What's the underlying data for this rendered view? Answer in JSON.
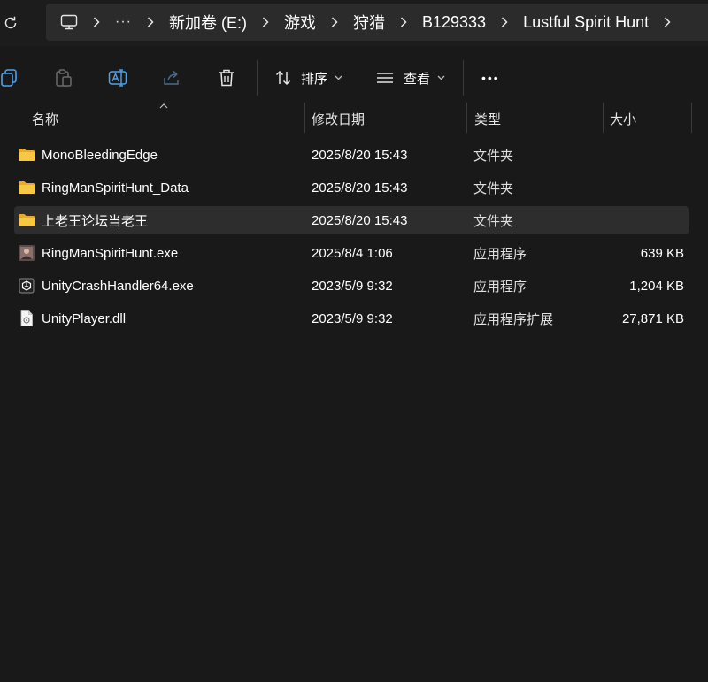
{
  "breadcrumb": {
    "overflow": "···",
    "segments": [
      "新加卷 (E:)",
      "游戏",
      "狩猎",
      "B129333",
      "Lustful Spirit Hunt"
    ]
  },
  "toolbar": {
    "sort_label": "排序",
    "view_label": "查看",
    "more_label": "•••"
  },
  "columns": {
    "name": "名称",
    "modified": "修改日期",
    "type": "类型",
    "size": "大小"
  },
  "files": [
    {
      "name": "MonoBleedingEdge",
      "modified": "2025/8/20 15:43",
      "type": "文件夹",
      "size": "",
      "icon": "folder-icon"
    },
    {
      "name": "RingManSpiritHunt_Data",
      "modified": "2025/8/20 15:43",
      "type": "文件夹",
      "size": "",
      "icon": "folder-icon"
    },
    {
      "name": "上老王论坛当老王",
      "modified": "2025/8/20 15:43",
      "type": "文件夹",
      "size": "",
      "icon": "folder-icon"
    },
    {
      "name": "RingManSpiritHunt.exe",
      "modified": "2025/8/4 1:06",
      "type": "应用程序",
      "size": "639 KB",
      "icon": "app-exe-icon"
    },
    {
      "name": "UnityCrashHandler64.exe",
      "modified": "2023/5/9 9:32",
      "type": "应用程序",
      "size": "1,204 KB",
      "icon": "unity-exe-icon"
    },
    {
      "name": "UnityPlayer.dll",
      "modified": "2023/5/9 9:32",
      "type": "应用程序扩展",
      "size": "27,871 KB",
      "icon": "dll-file-icon"
    }
  ],
  "selected_index": 2,
  "colors": {
    "background": "#191919",
    "folder": "#f8c845",
    "selected_row": "#2d2d2d"
  }
}
